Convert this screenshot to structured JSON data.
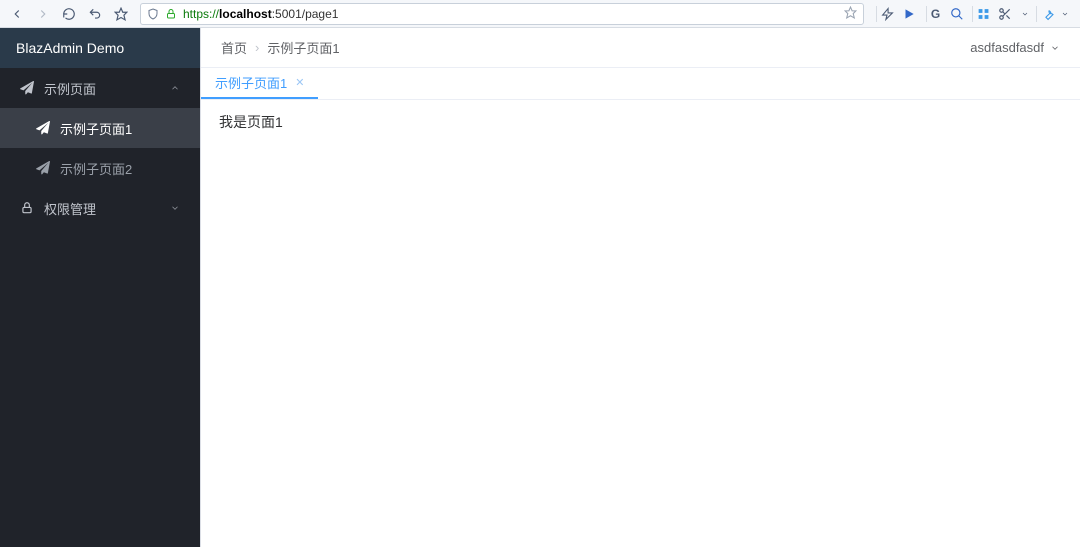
{
  "browser": {
    "url_scheme": "https",
    "url_host": "localhost",
    "url_port": ":5001",
    "url_path": "/page1"
  },
  "app": {
    "title": "BlazAdmin Demo"
  },
  "sidebar": {
    "groups": [
      {
        "label": "示例页面",
        "expanded": true,
        "items": [
          {
            "label": "示例子页面1",
            "active": true
          },
          {
            "label": "示例子页面2",
            "active": false
          }
        ]
      },
      {
        "label": "权限管理",
        "expanded": false,
        "items": []
      }
    ]
  },
  "breadcrumbs": [
    "首页",
    "示例子页面1"
  ],
  "user": {
    "name": "asdfasdfasdf"
  },
  "tabs": [
    {
      "label": "示例子页面1",
      "active": true
    }
  ],
  "page": {
    "body": "我是页面1"
  }
}
